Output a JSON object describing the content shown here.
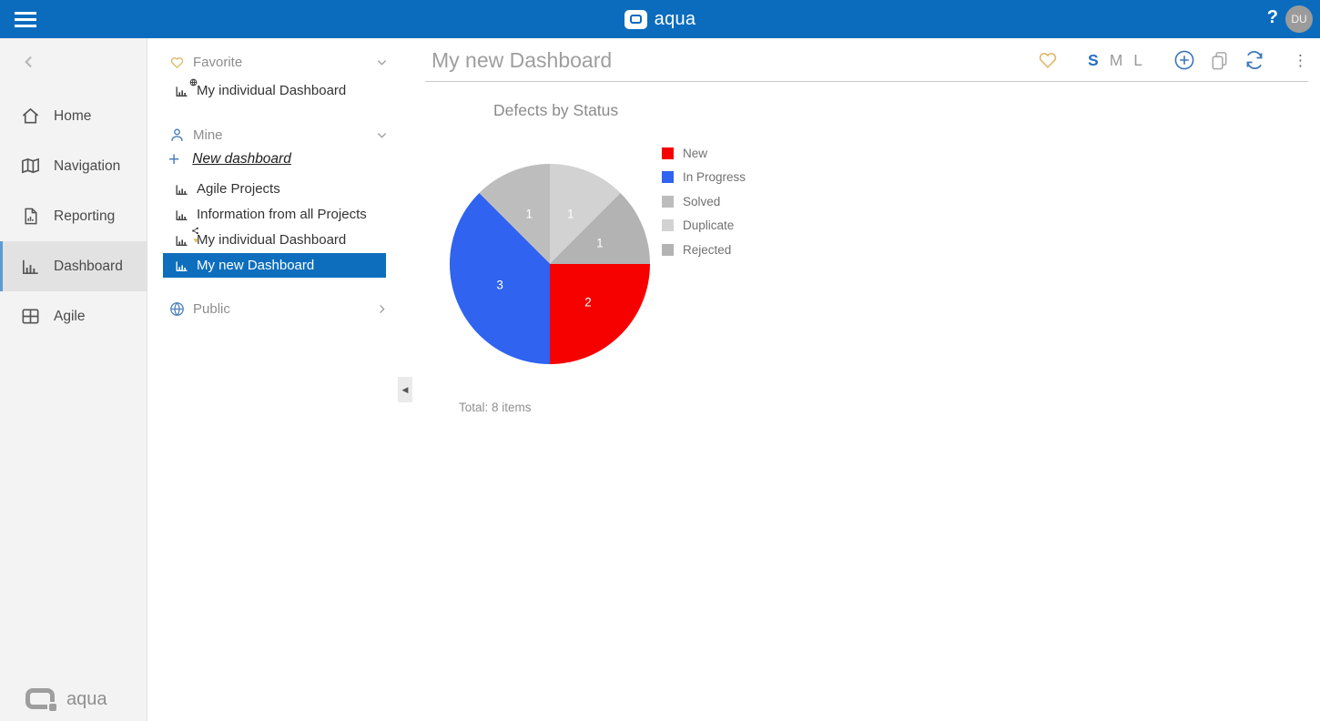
{
  "topbar": {
    "brand": "aqua",
    "help_label": "?",
    "avatar_initials": "DU"
  },
  "sidebar": {
    "items": [
      "Home",
      "Navigation",
      "Reporting",
      "Dashboard",
      "Agile"
    ],
    "selected_item": "Dashboard",
    "brand": "aqua"
  },
  "panel": {
    "favorite": {
      "label": "Favorite",
      "item": "My individual Dashboard"
    },
    "mine": {
      "label": "Mine",
      "new_link": "New dashboard",
      "items": [
        "Agile Projects",
        "Information from all Projects",
        "My individual Dashboard",
        "My new Dashboard"
      ],
      "selected_item": "My new Dashboard"
    },
    "public_section": {
      "label": "Public"
    }
  },
  "main": {
    "title": "My new Dashboard",
    "sizes": [
      "S",
      "M",
      "L"
    ],
    "selected_size": "S"
  },
  "colors": {
    "topbar_blue": "#0b6cbe",
    "selection_blue": "#0d6ebd",
    "favorite_gold": "#dfb869"
  },
  "chart_data": {
    "type": "pie",
    "title": "Defects by Status",
    "series": [
      {
        "label": "New",
        "value": 2,
        "color": "#f60000"
      },
      {
        "label": "In Progress",
        "value": 3,
        "color": "#2f63f0"
      },
      {
        "label": "Solved",
        "value": 1,
        "color": "#bdbdbd"
      },
      {
        "label": "Duplicate",
        "value": 1,
        "color": "#d2d2d2"
      },
      {
        "label": "Rejected",
        "value": 1,
        "color": "#b3b3b3"
      }
    ],
    "start_angle_deg": 90,
    "legend_position": "right",
    "total_items": 8,
    "total_label": "Total: 8 items"
  }
}
